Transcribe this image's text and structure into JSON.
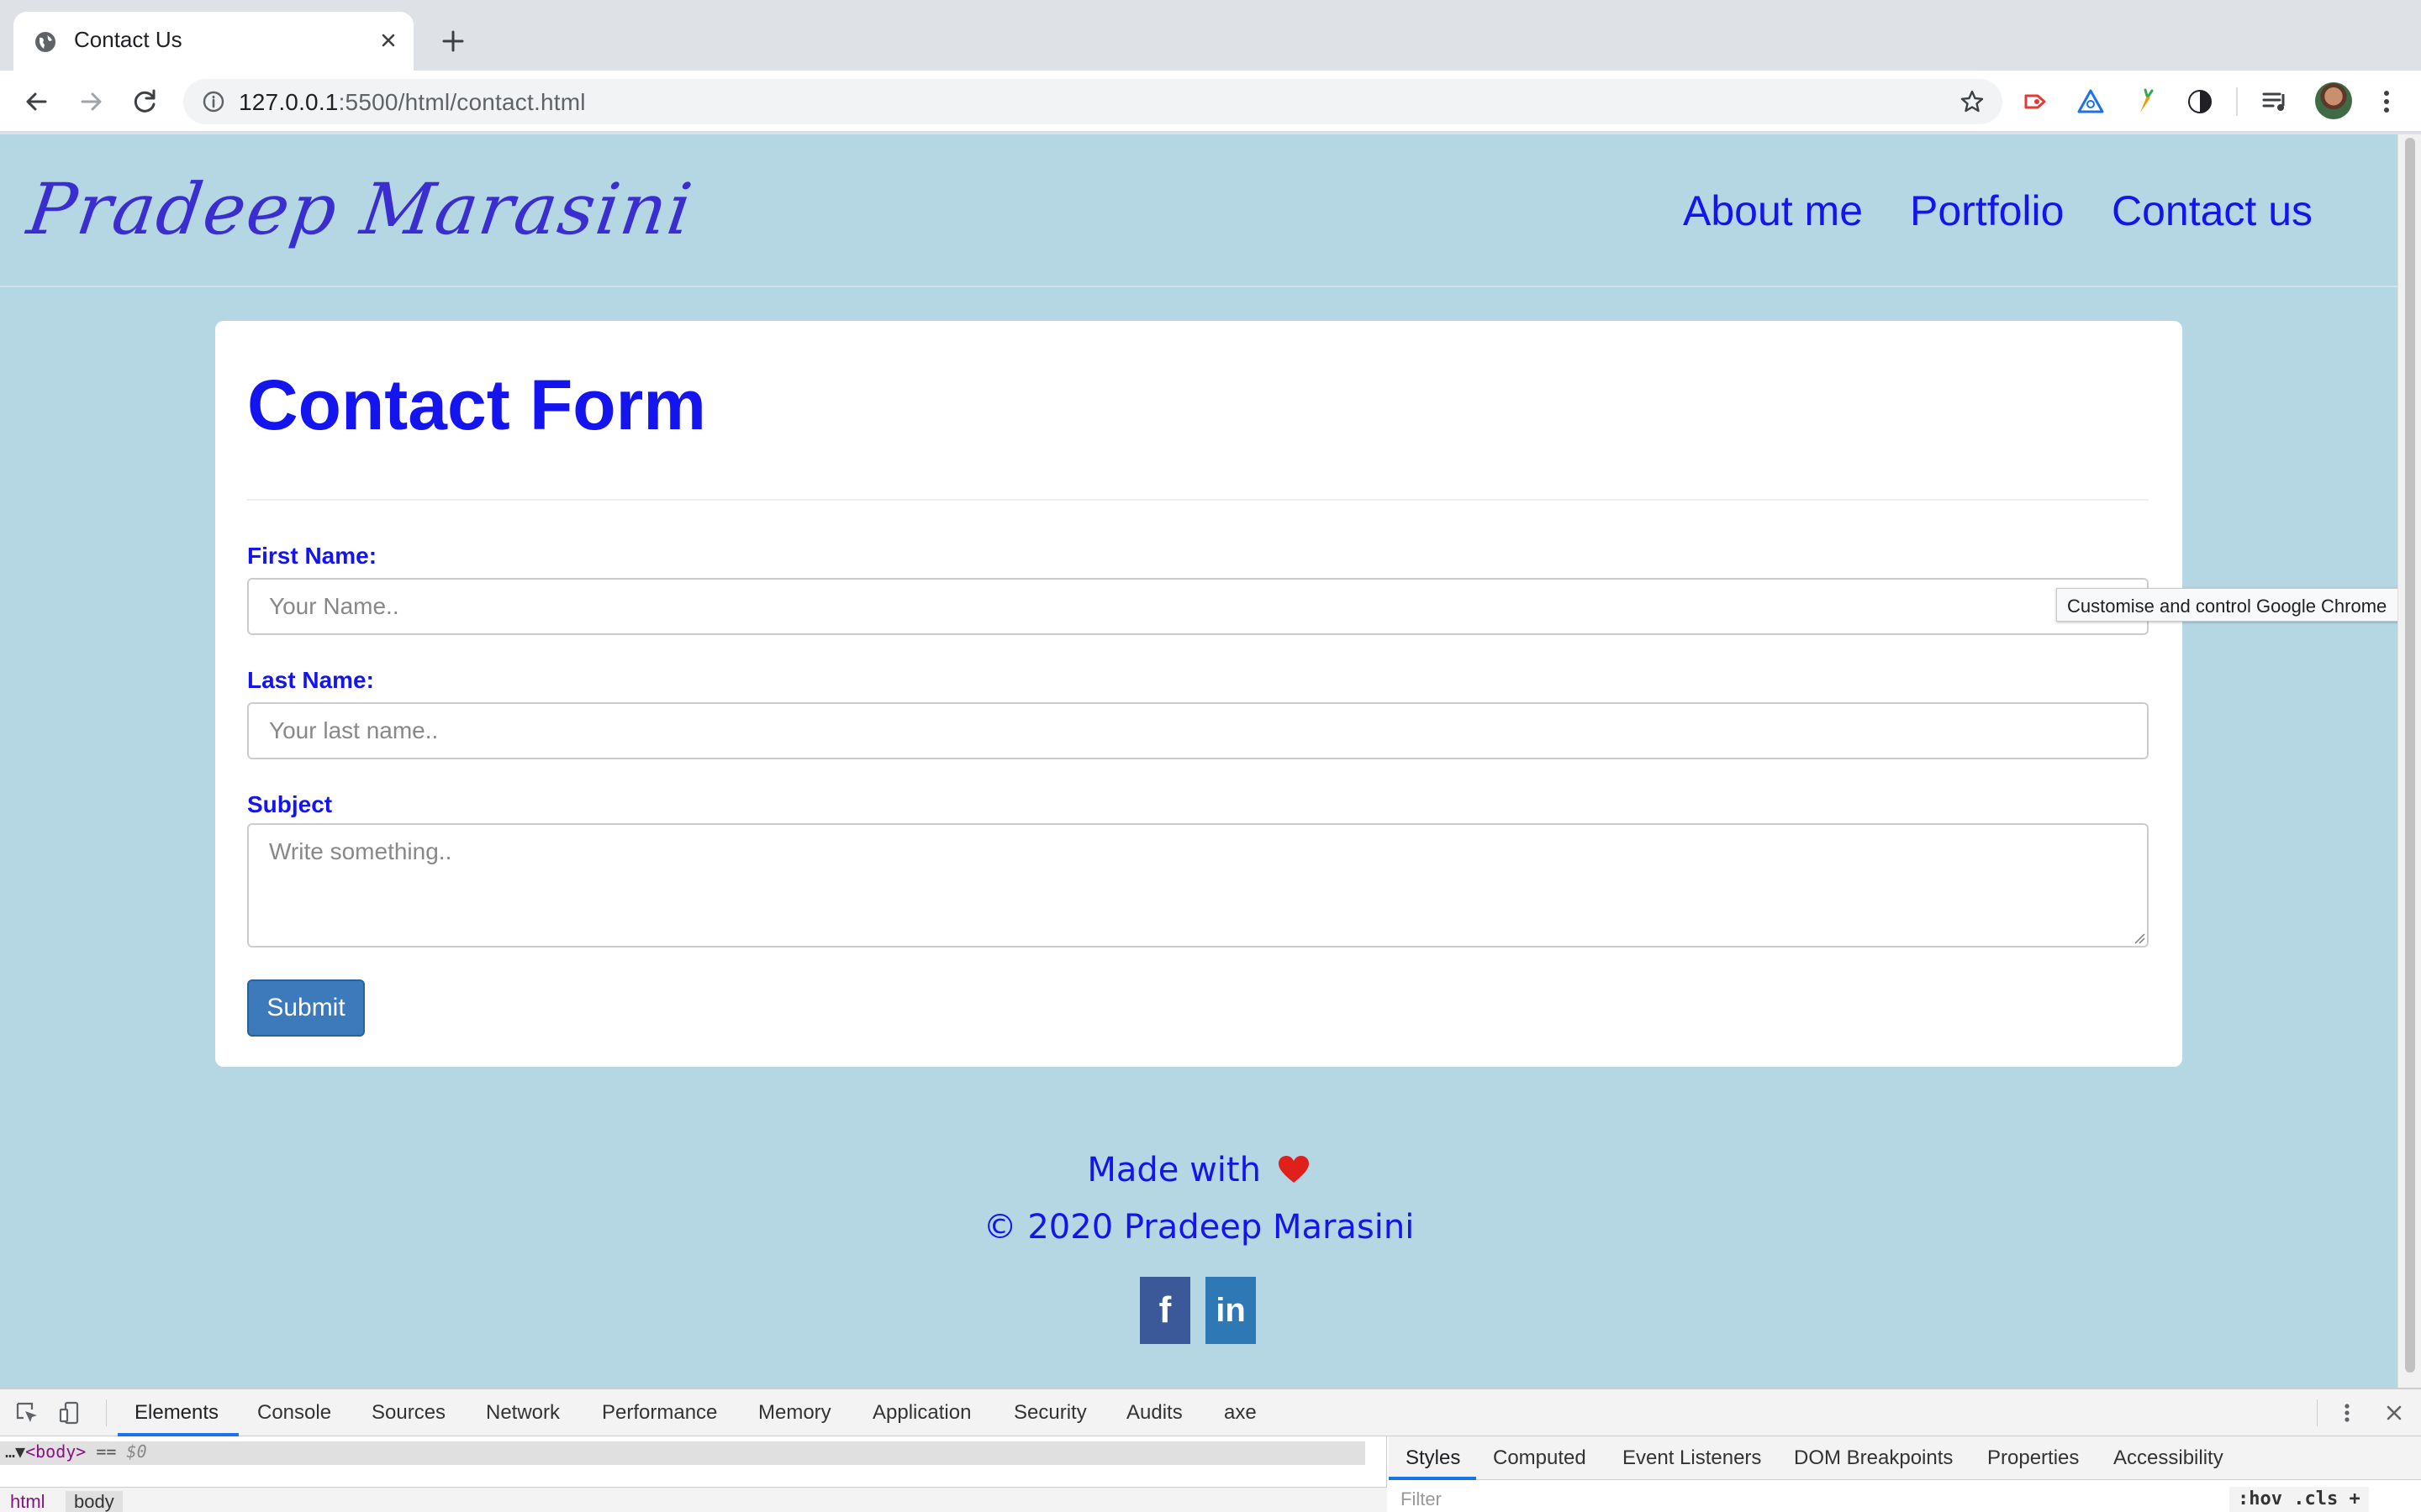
{
  "browser": {
    "tab_title": "Contact Us",
    "url_host": "127.0.0.1",
    "url_rest": ":5500/html/contact.html",
    "tooltip": "Customise and control Google Chrome",
    "icons": [
      "globe-icon",
      "close-icon",
      "plus-icon",
      "back-icon",
      "forward-icon",
      "reload-icon",
      "info-icon",
      "star-icon",
      "extension-icon",
      "avatar",
      "kebab-menu-icon"
    ]
  },
  "site": {
    "logo": "Pradeep Marasini",
    "nav": [
      "About me",
      "Portfolio",
      "Contact us"
    ],
    "colors": {
      "background": "#b5d7e3",
      "primary": "#1414ee",
      "button": "#3d7abc"
    }
  },
  "form": {
    "title": "Contact Form",
    "first_name_label": "First Name:",
    "first_name_placeholder": "Your Name..",
    "last_name_label": "Last Name:",
    "last_name_placeholder": "Your last name..",
    "subject_label": "Subject",
    "subject_placeholder": "Write something..",
    "submit_label": "Submit"
  },
  "footer": {
    "made_with": "Made with",
    "heart": "❤",
    "copyright": "© 2020 Pradeep Marasini",
    "social": [
      {
        "name": "facebook",
        "glyph": "f"
      },
      {
        "name": "linkedin",
        "glyph": "in"
      }
    ]
  },
  "devtools": {
    "tabs": [
      "Elements",
      "Console",
      "Sources",
      "Network",
      "Performance",
      "Memory",
      "Application",
      "Security",
      "Audits",
      "axe"
    ],
    "active_tab": "Elements",
    "dom_tag": "<body>",
    "dom_eq": "==",
    "dom_ref": "$0",
    "breadcrumbs": [
      "html",
      "body"
    ],
    "side_tabs": [
      "Styles",
      "Computed",
      "Event Listeners",
      "DOM Breakpoints",
      "Properties",
      "Accessibility"
    ],
    "filter_placeholder": "Filter",
    "side_buttons": ":hov .cls +"
  }
}
